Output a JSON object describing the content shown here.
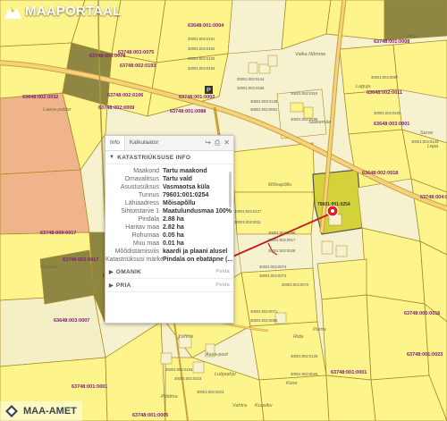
{
  "brand": {
    "name": "MAAPORTAAL",
    "accent": "#f1c232"
  },
  "attribution": "MAA-AMET",
  "colors": {
    "yellow": "#fef48c",
    "olive": "#8e8744",
    "orange": "#f0b48a",
    "selected": "#d4d23a",
    "road": "#f7d27c",
    "label_purple": "#7a1a78",
    "label_gray": "#555555",
    "marker": "#e02020"
  },
  "parcels": {
    "big": [
      "63748:004:0078",
      "63748:003:0075",
      "63748:002:0193",
      "63748:002:0106",
      "63748:002:0009",
      "63648:002:0032",
      "63748:001:0088",
      "63748:003:0016",
      "63748:009:0017",
      "63748:002:0017",
      "63648:003:0021",
      "63648:003:0007",
      "63748:001:0001",
      "63748:001:0005",
      "63748:001:0002",
      "63648:001:0004",
      "63748:001:0008",
      "63648:002:0011",
      "63648:003:0001",
      "63648:002:0018",
      "63748:004:0011",
      "63748:005:0016",
      "63748:001:0023",
      "63748:001:0001"
    ],
    "small": [
      "30001:002:0181",
      "30001:002:0182",
      "30001:002:0183",
      "30001:002:0184",
      "30001:002:0144",
      "30001:002:0156",
      "30001:002:0138",
      "30001:002:0001",
      "30001:002:0119",
      "30001:002:0199",
      "30001:002:0087",
      "30001:002:0100",
      "30001:002:0127",
      "30001:002:0011",
      "30001:002:0098",
      "30001:002:0017",
      "30001:002:0028",
      "30001:002:0074",
      "30001:002:0073",
      "30001:002:0072",
      "30001:002:0071",
      "30001:002:0086",
      "30001:002:0114",
      "30001:002:0194",
      "30001:002:0223",
      "30001:002:0223",
      "30001:002:0126",
      "30001:002:0025",
      "30001:002:0143"
    ]
  },
  "places": [
    "Laeva polder",
    "Vaika Nõmme",
    "Laguja",
    "Saaremäe",
    "Mõisapõllu",
    "Raudmäe",
    "Sarve",
    "Lepa",
    "Aasa",
    "Kurelao",
    "Lõhmu",
    "Lehise",
    "Aasa-pool",
    "Lubjaahju",
    "Kuusiku",
    "Rida",
    "Pärna",
    "Kase",
    "Vahtra",
    "Põldma"
  ],
  "selected_parcel": "79601:001:0254",
  "panel": {
    "tabs": [
      "Info",
      "Kalkulaator"
    ],
    "tool_icons": [
      "share-icon",
      "print-icon",
      "close-icon"
    ],
    "section_title": "KATASTRIÜKSUSE INFO",
    "rows": [
      {
        "k": "Maakond",
        "v": "Tartu maakond"
      },
      {
        "k": "Omavalitsus",
        "v": "Tartu vald"
      },
      {
        "k": "Asustusüksus",
        "v": "Vasmaotsa küla"
      },
      {
        "k": "Tunnus",
        "v": "79601:001:0254"
      },
      {
        "k": "Lähiaadress",
        "v": "Mõisapõllu"
      },
      {
        "k": "Sihtotstarve 1",
        "v": "Maatulundusmaa 100%"
      },
      {
        "k": "Pindala",
        "v": "2.88 ha"
      },
      {
        "k": "Haritav maa",
        "v": "2.82 ha"
      },
      {
        "k": "Rohumaa",
        "v": "0.05 ha"
      },
      {
        "k": "Muu maa",
        "v": "0.01 ha"
      },
      {
        "k": "Mõõdistamisviis",
        "v": "kaardi ja plaani alusel"
      },
      {
        "k": "Katastriüksusi märked",
        "v": "Pindala on ebatäpne (..."
      }
    ],
    "sections": [
      {
        "title": "OMANIK",
        "act": "Peida"
      },
      {
        "title": "PRIA",
        "act": "Peida"
      }
    ],
    "section_act": "Peida"
  }
}
